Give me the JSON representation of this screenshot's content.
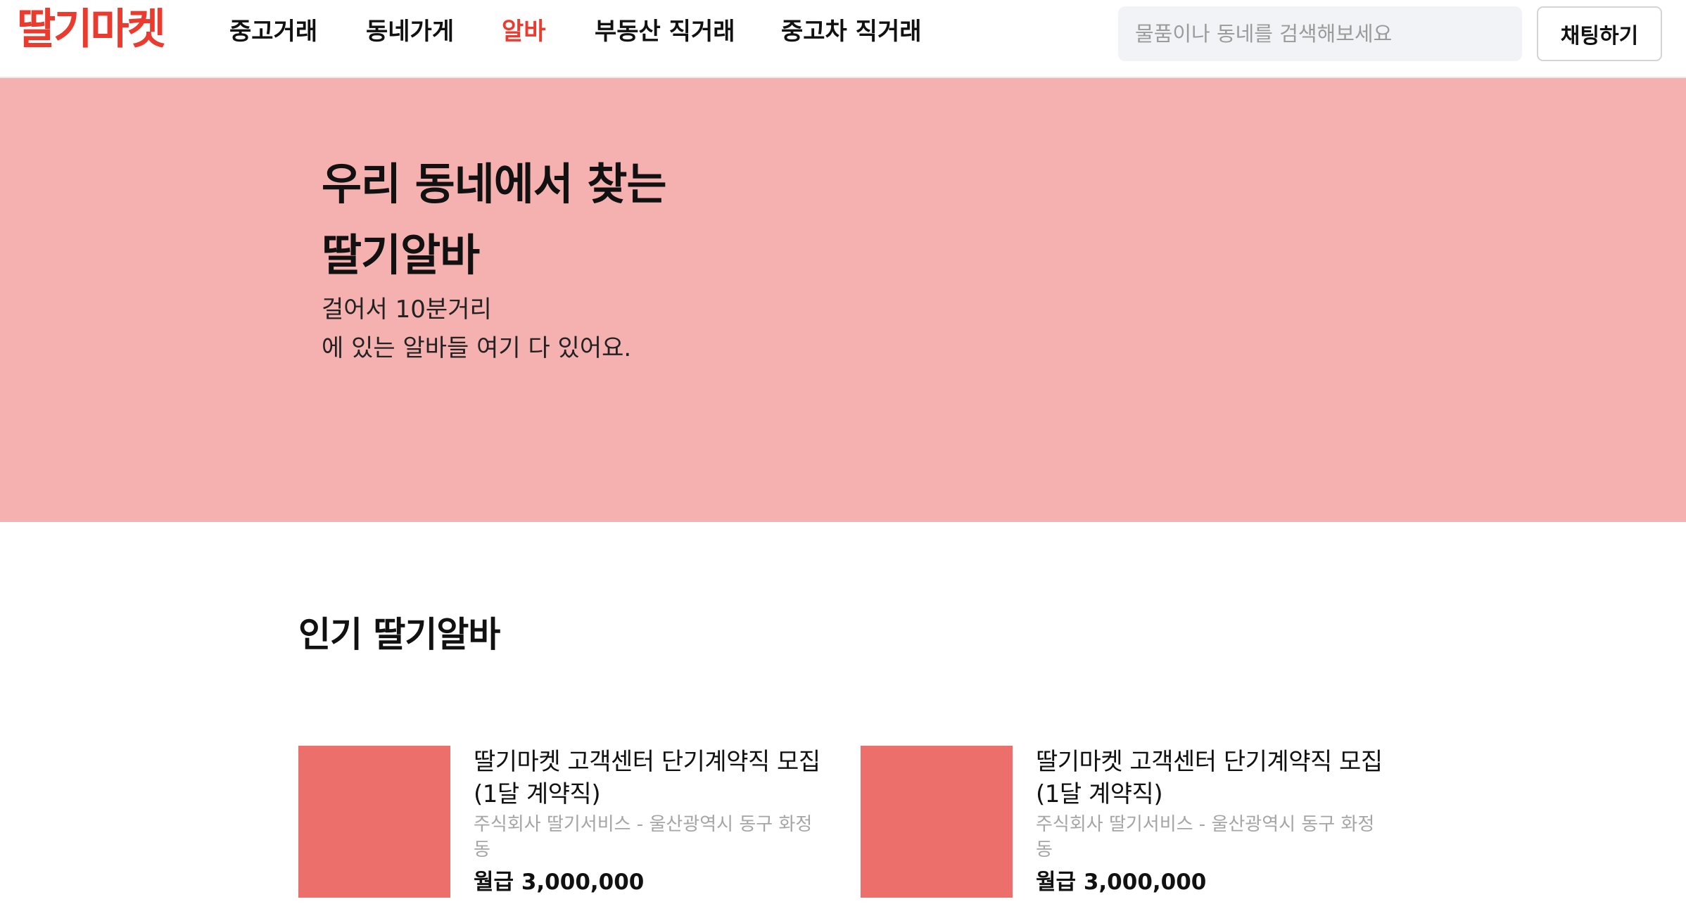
{
  "header": {
    "logo": "딸기마켓",
    "nav": [
      {
        "label": "중고거래",
        "active": false
      },
      {
        "label": "동네가게",
        "active": false
      },
      {
        "label": "알바",
        "active": true
      },
      {
        "label": "부동산 직거래",
        "active": false
      },
      {
        "label": "중고차 직거래",
        "active": false
      }
    ],
    "search_placeholder": "물품이나 동네를 검색해보세요",
    "chat_label": "채팅하기"
  },
  "hero": {
    "title_line1": "우리 동네에서 찾는",
    "title_line2": "딸기알바",
    "desc_line1": "걸어서 10분거리",
    "desc_line2": "에 있는 알바들 여기 다 있어요."
  },
  "popular": {
    "heading": "인기 딸기알바",
    "jobs": [
      {
        "title": "딸기마켓 고객센터 단기계약직 모집(1달 계약직)",
        "company": "주식회사 딸기서비스 - 울산광역시 동구 화정동",
        "salary": "월급 3,000,000"
      },
      {
        "title": "딸기마켓 고객센터 단기계약직 모집(1달 계약직)",
        "company": "주식회사 딸기서비스 - 울산광역시 동구 화정동",
        "salary": "월급 3,000,000"
      }
    ]
  },
  "colors": {
    "brand": "#ea3b2e",
    "hero_bg": "#f4b1b0",
    "thumb": "#ed6f6b"
  }
}
